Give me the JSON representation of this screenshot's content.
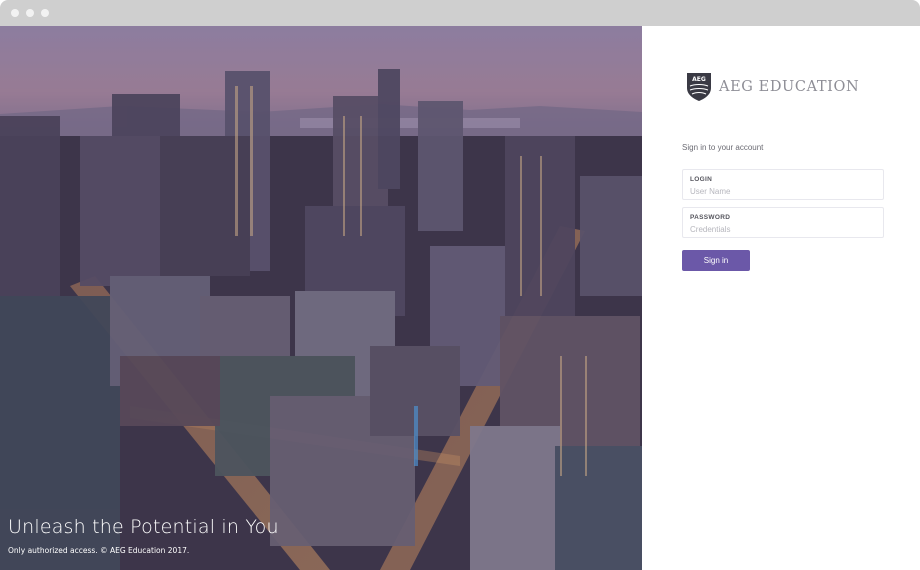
{
  "hero": {
    "title": "Unleash the Potential in You",
    "footer_note": "Only authorized access. © AEG Education 2017."
  },
  "brand": {
    "name": "AEG EDUCATION",
    "logo_text": "AEG"
  },
  "login_form": {
    "heading": "Sign in to your account",
    "login_label": "LOGIN",
    "login_placeholder": "User Name",
    "login_value": "",
    "password_label": "PASSWORD",
    "password_placeholder": "Credentials",
    "password_value": "",
    "submit_label": "Sign in"
  },
  "colors": {
    "accent": "#6b58a8",
    "brand_text": "#8e8e96",
    "titlebar": "#cfcfcf"
  }
}
